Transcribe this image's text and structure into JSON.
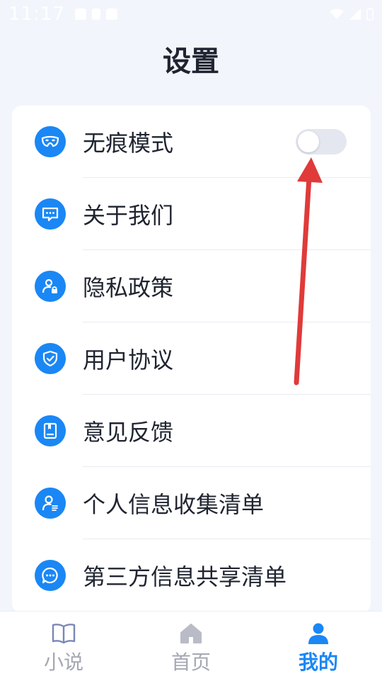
{
  "status_bar": {
    "time": "11:17"
  },
  "page": {
    "title": "设置"
  },
  "settings": {
    "items": [
      {
        "label": "无痕模式",
        "icon": "mask-icon",
        "toggle_on": false
      },
      {
        "label": "关于我们",
        "icon": "chat-bubble-icon"
      },
      {
        "label": "隐私政策",
        "icon": "user-lock-icon"
      },
      {
        "label": "用户协议",
        "icon": "shield-check-icon"
      },
      {
        "label": "意见反馈",
        "icon": "notebook-icon"
      },
      {
        "label": "个人信息收集清单",
        "icon": "user-list-icon"
      },
      {
        "label": "第三方信息共享清单",
        "icon": "ellipsis-bubble-icon"
      }
    ]
  },
  "tab_bar": {
    "tabs": [
      {
        "label": "小说",
        "icon": "book-icon",
        "active": false
      },
      {
        "label": "首页",
        "icon": "home-icon",
        "active": false
      },
      {
        "label": "我的",
        "icon": "person-icon",
        "active": true
      }
    ]
  },
  "colors": {
    "accent": "#1a87f5",
    "background": "#f2f5fb",
    "text": "#1f2430",
    "inactive_tab": "#a4a8b3",
    "annotation_arrow": "#e03a3a"
  }
}
